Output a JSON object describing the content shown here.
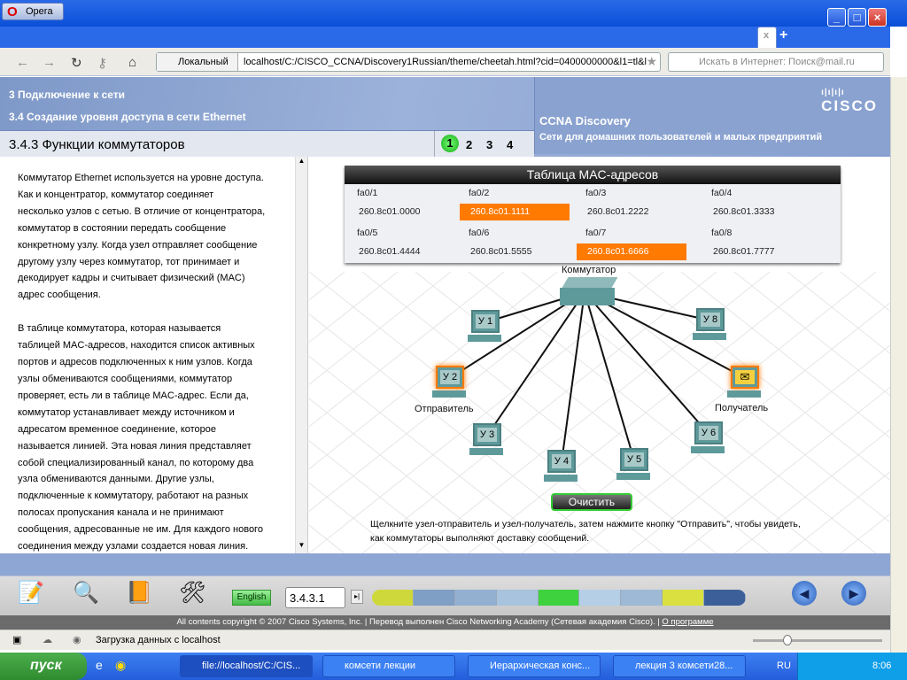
{
  "browser": {
    "name": "Opera",
    "url": "localhost/C:/CISCO_CCNA/Discovery1Russian/theme/cheetah.html?cid=0400000000&l1=tl&l",
    "location_label": "Локальный",
    "search_placeholder": "Искать в Интернет: Поиск@mail.ru",
    "tab_close": "x",
    "tab_add": "+"
  },
  "header": {
    "chapter": "3 Подключение к сети",
    "section": "3.4 Создание уровня доступа в сети Ethernet",
    "brand": "CCNA Discovery",
    "subtitle": "Сети для домашних пользователей и малых предприятий",
    "logo": "CISCO",
    "page_title": "3.4.3 Функции коммутаторов",
    "pages": [
      "1",
      "2",
      "3",
      "4"
    ],
    "current_page": 1
  },
  "left_text": [
    [
      "Коммутатор Ethernet используется на уровне доступа.",
      "Как и концентратор, коммутатор соединяет",
      "несколько узлов с сетью. В отличие от концентратора,",
      "коммутатор в состоянии передать сообщение",
      "конкретному узлу. Когда узел отправляет сообщение",
      "другому узлу через коммутатор, тот принимает и",
      "декодирует кадры и считывает физический (MAC)",
      "адрес сообщения."
    ],
    [
      "В таблице коммутатора, которая называется",
      "таблицей MAC-адресов, находится список активных",
      "портов и адресов подключенных к ним узлов. Когда",
      "узлы обмениваются сообщениями, коммутатор",
      "проверяет, есть ли в таблице MAC-адрес. Если да,",
      "коммутатор устанавливает между источником и",
      "адресатом временное соединение, которое",
      "называется линией. Эта новая линия представляет",
      "собой специализированный канал, по которому два",
      "узла обмениваются данными. Другие узлы,",
      "подключенные к коммутатору, работают на разных",
      "полосах пропускания канала и не принимают",
      "сообщения, адресованные не им. Для каждого нового",
      "соединения между узлами создается новая линия."
    ]
  ],
  "mac_table": {
    "title": "Таблица MAC-адресов",
    "entries": [
      {
        "port": "fa0/1",
        "mac": "260.8c01.0000",
        "highlight": false
      },
      {
        "port": "fa0/2",
        "mac": "260.8c01.1111",
        "highlight": true
      },
      {
        "port": "fa0/3",
        "mac": "260.8c01.2222",
        "highlight": false
      },
      {
        "port": "fa0/4",
        "mac": "260.8c01.3333",
        "highlight": false
      },
      {
        "port": "fa0/5",
        "mac": "260.8c01.4444",
        "highlight": false
      },
      {
        "port": "fa0/6",
        "mac": "260.8c01.5555",
        "highlight": false
      },
      {
        "port": "fa0/7",
        "mac": "260.8c01.6666",
        "highlight": true
      },
      {
        "port": "fa0/8",
        "mac": "260.8c01.7777",
        "highlight": false
      }
    ]
  },
  "diagram": {
    "switch_label": "Коммутатор",
    "sender_label": "Отправитель",
    "receiver_label": "Получатель",
    "nodes": [
      {
        "label": "У 1",
        "state": "normal"
      },
      {
        "label": "У 2",
        "state": "sender"
      },
      {
        "label": "У 3",
        "state": "normal"
      },
      {
        "label": "У 4",
        "state": "normal"
      },
      {
        "label": "У 5",
        "state": "normal"
      },
      {
        "label": "У 6",
        "state": "normal"
      },
      {
        "label": "",
        "state": "receiver"
      },
      {
        "label": "У 8",
        "state": "normal"
      }
    ],
    "clear_button": "Очистить",
    "hint": "Щелкните узел-отправитель и узел-получатель, затем нажмите кнопку \"Отправить\", чтобы увидеть, как коммутаторы выполняют доставку сообщений."
  },
  "toolbar": {
    "language": "English",
    "page_number": "3.4.3.1",
    "progress_colors": [
      "#cfd83a",
      "#7f9fc4",
      "#93b0d0",
      "#a8c3dd",
      "#3fd23f",
      "#b5cfe6",
      "#9db9d6",
      "#d9e03f",
      "#3d5f99"
    ]
  },
  "footer": {
    "copyright": "All contents copyright © 2007 Cisco Systems, Inc. | Перевод выполнен Cisco Networking Academy (Сетевая академия Cisco). | ",
    "about": "О программе"
  },
  "status": {
    "text": "Загрузка данных с localhost"
  },
  "taskbar": {
    "start": "пуск",
    "tasks": [
      "file://localhost/C:/CIS...",
      "комсети лекции",
      "Иерархическая конс...",
      "лекция 3 комсети28..."
    ],
    "lang": "RU",
    "time": "8:06"
  }
}
